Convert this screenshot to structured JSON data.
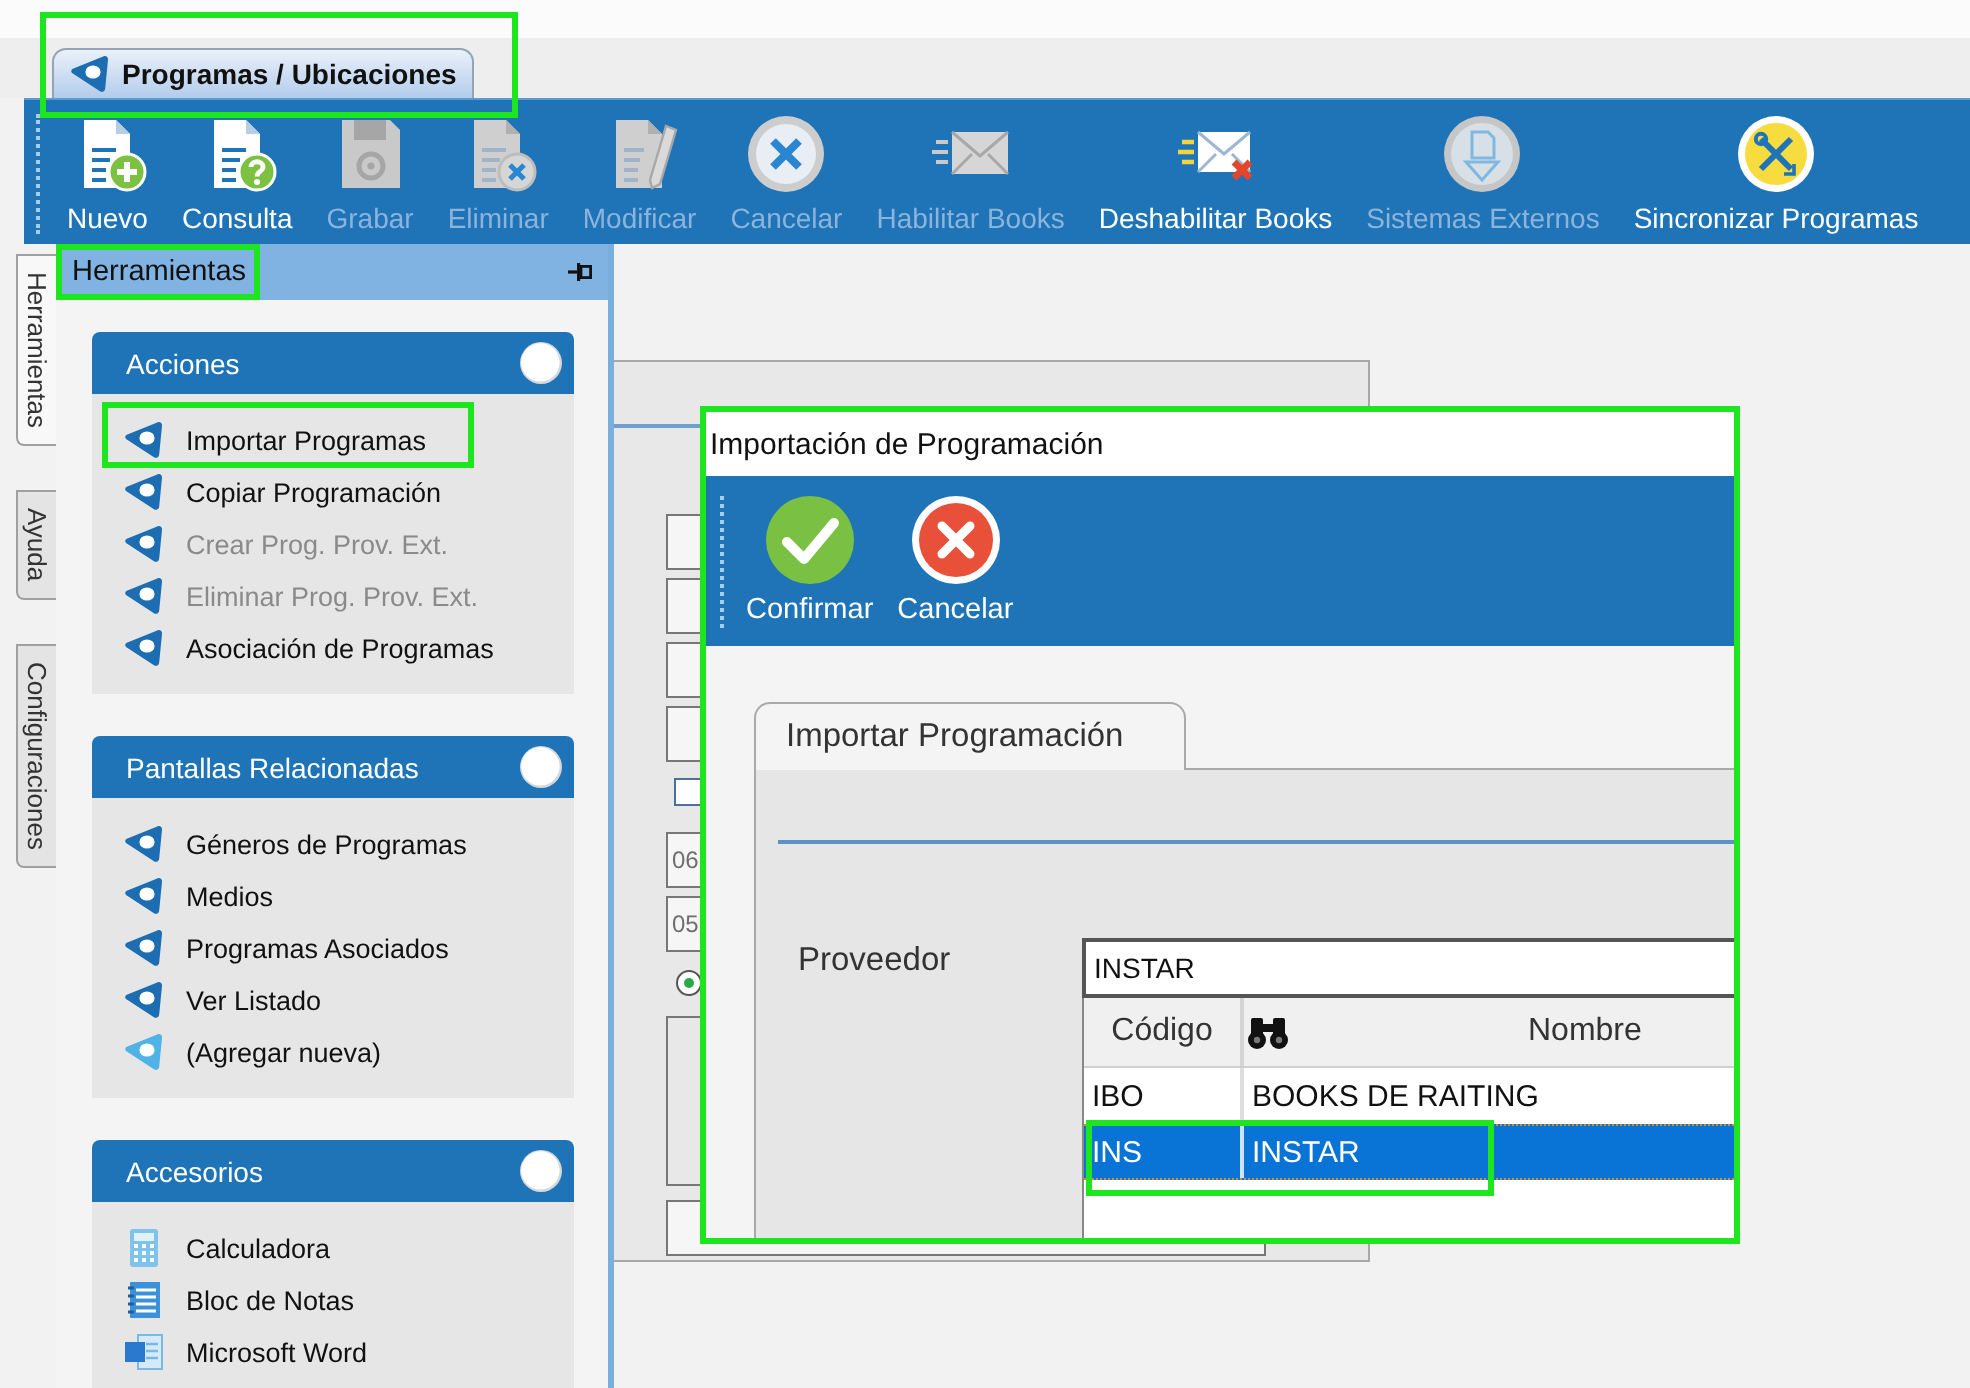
{
  "tab": {
    "label": "Programas / Ubicaciones",
    "selected": true,
    "highlighted": true
  },
  "toolbar": {
    "buttons": [
      {
        "label": "Nuevo",
        "disabled": false
      },
      {
        "label": "Consulta",
        "disabled": false
      },
      {
        "label": "Grabar",
        "disabled": true
      },
      {
        "label": "Eliminar",
        "disabled": true
      },
      {
        "label": "Modificar",
        "disabled": true
      },
      {
        "label": "Cancelar",
        "disabled": true
      },
      {
        "label": "Habilitar Books",
        "disabled": true
      },
      {
        "label": "Deshabilitar Books",
        "disabled": false
      },
      {
        "label": "Sistemas Externos",
        "disabled": true
      },
      {
        "label": "Sincronizar Programas",
        "disabled": false
      }
    ]
  },
  "side_tabs": [
    {
      "label": "Herramientas",
      "selected": true
    },
    {
      "label": "Ayuda",
      "selected": false
    },
    {
      "label": "Configuraciones",
      "selected": false
    }
  ],
  "panel": {
    "title": "Herramientas",
    "highlighted": true,
    "groups": [
      {
        "title": "Acciones",
        "items": [
          {
            "label": "Importar Programas",
            "kind": "link",
            "disabled": false,
            "highlighted": true
          },
          {
            "label": "Copiar Programación",
            "kind": "link",
            "disabled": false,
            "highlighted": false
          },
          {
            "label": "Crear Prog. Prov. Ext.",
            "kind": "link",
            "disabled": true,
            "highlighted": false
          },
          {
            "label": "Eliminar Prog. Prov. Ext.",
            "kind": "link",
            "disabled": true,
            "highlighted": false
          },
          {
            "label": "Asociación de Programas",
            "kind": "link",
            "disabled": false,
            "highlighted": false
          }
        ]
      },
      {
        "title": "Pantallas Relacionadas",
        "items": [
          {
            "label": "Géneros de Programas",
            "kind": "link",
            "disabled": false,
            "highlighted": false
          },
          {
            "label": "Medios",
            "kind": "link",
            "disabled": false,
            "highlighted": false
          },
          {
            "label": "Programas Asociados",
            "kind": "link",
            "disabled": false,
            "highlighted": false
          },
          {
            "label": "Ver Listado",
            "kind": "link",
            "disabled": false,
            "highlighted": false
          },
          {
            "label": "(Agregar nueva)",
            "kind": "add",
            "disabled": false,
            "highlighted": false
          }
        ]
      },
      {
        "title": "Accesorios",
        "items": [
          {
            "label": "Calculadora",
            "kind": "app",
            "disabled": false,
            "highlighted": false
          },
          {
            "label": "Bloc de Notas",
            "kind": "app",
            "disabled": false,
            "highlighted": false
          },
          {
            "label": "Microsoft Word",
            "kind": "app",
            "disabled": false,
            "highlighted": false
          }
        ]
      }
    ]
  },
  "background_form": {
    "fields": [
      {
        "kind": "input"
      },
      {
        "kind": "input"
      },
      {
        "kind": "input"
      },
      {
        "kind": "input"
      },
      {
        "kind": "checkbox",
        "checked": false
      },
      {
        "kind": "input",
        "value": "06"
      },
      {
        "kind": "input",
        "value": "05"
      },
      {
        "kind": "radio",
        "selected": true
      },
      {
        "kind": "area"
      },
      {
        "kind": "input"
      }
    ]
  },
  "dialog": {
    "title": "Importación de Programación",
    "highlighted": true,
    "buttons": [
      {
        "label": "Confirmar"
      },
      {
        "label": "Cancelar"
      }
    ],
    "tabs": [
      {
        "label": "Importar Programación",
        "selected": true
      }
    ],
    "field": {
      "label": "Proveedor",
      "value": "INSTAR"
    },
    "grid": {
      "columns": [
        "Código",
        "Nombre"
      ],
      "rows": [
        {
          "cells": [
            "IBO",
            "BOOKS DE RAITING"
          ],
          "selected": false,
          "highlighted": false
        },
        {
          "cells": [
            "INS",
            "INSTAR"
          ],
          "selected": true,
          "highlighted": true
        }
      ]
    }
  }
}
